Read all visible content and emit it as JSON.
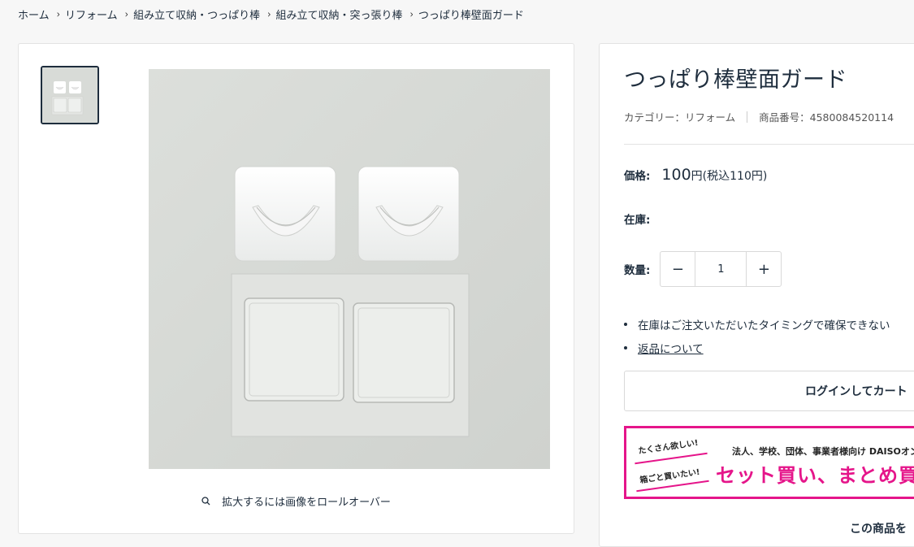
{
  "breadcrumb": {
    "items": [
      "ホーム",
      "リフォーム",
      "組み立て収納・つっぱり棒",
      "組み立て収納・突っ張り棒",
      "つっぱり棒壁面ガード"
    ],
    "separator": "›"
  },
  "gallery": {
    "thumbnail_alt": "つっぱり棒壁面ガード",
    "main_image_alt": "つっぱり棒壁面ガード",
    "zoom_hint": "拡大するには画像をロールオーバー"
  },
  "product": {
    "title": "つっぱり棒壁面ガード",
    "category_label": "カテゴリー：リフォーム",
    "sku_label": "商品番号：4580084520114",
    "price_label": "価格:",
    "price_amount": "100",
    "price_suffix": "円(税込110円)",
    "stock_label": "在庫:",
    "stock_value": "",
    "quantity_label": "数量:",
    "quantity_value": "1",
    "minus": "−",
    "plus": "+",
    "notes": [
      "在庫はご注文いただいたタイミングで確保できない",
      "返品について"
    ],
    "cart_button": "ログインしてカート"
  },
  "banner": {
    "tag1": "たくさん欲しい!",
    "tag2": "箱ごと買いたい!",
    "line1": "法人、学校、団体、事業者様向け DAISOオンラ",
    "line2": "セット買い、まとめ買いは"
  },
  "more_heading": "この商品を",
  "colors": {
    "accent": "#e5158a",
    "text": "#1e2d3d"
  }
}
